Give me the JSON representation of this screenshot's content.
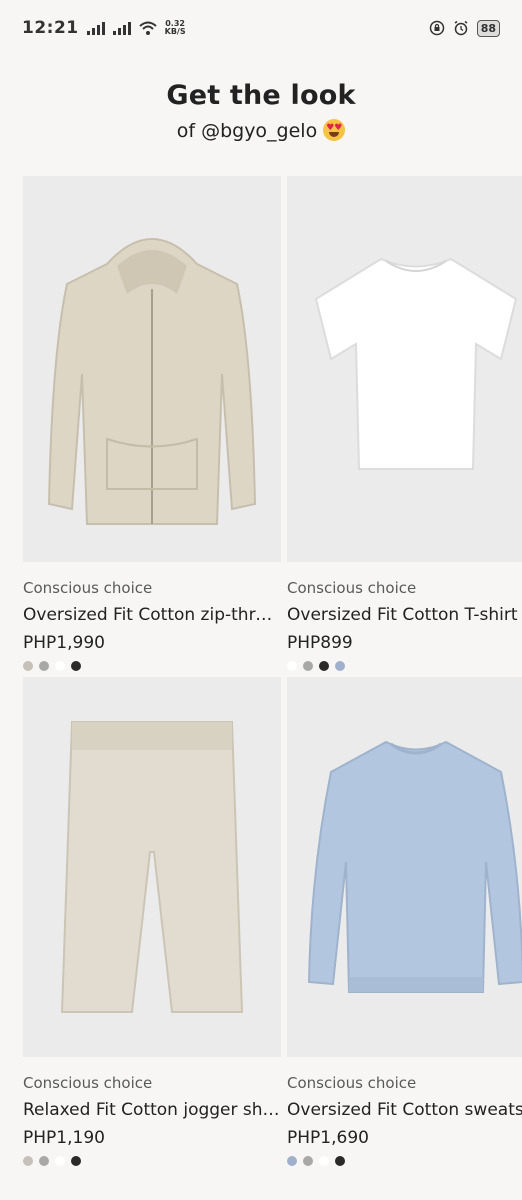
{
  "status": {
    "time": "12:21",
    "net_rate": "0.32",
    "net_unit": "KB/S",
    "battery": "88"
  },
  "page": {
    "title": "Get the look",
    "subtitle": "of @bgyo_gelo"
  },
  "products": [
    {
      "tag": "Conscious choice",
      "name": "Oversized Fit Cotton zip-through hoodie",
      "price": "PHP1,990",
      "swatches": [
        "#c5c1b8",
        "#a8a8a8",
        "#ffffff",
        "#2a2a2a"
      ]
    },
    {
      "tag": "Conscious choice",
      "name": "Oversized Fit Cotton T-shirt",
      "price": "PHP899",
      "swatches": [
        "#ffffff",
        "#a8a8a8",
        "#2a2a2a",
        "#9fb0cc"
      ]
    },
    {
      "tag": "Conscious choice",
      "name": "Relaxed Fit Cotton jogger shorts",
      "price": "PHP1,190",
      "swatches": [
        "#c5c1b8",
        "#a8a8a8",
        "#ffffff",
        "#2a2a2a"
      ]
    },
    {
      "tag": "Conscious choice",
      "name": "Oversized Fit Cotton sweatshirt",
      "price": "PHP1,690",
      "swatches": [
        "#9fb0cc",
        "#a8a8a8",
        "#ffffff",
        "#2a2a2a"
      ]
    }
  ]
}
